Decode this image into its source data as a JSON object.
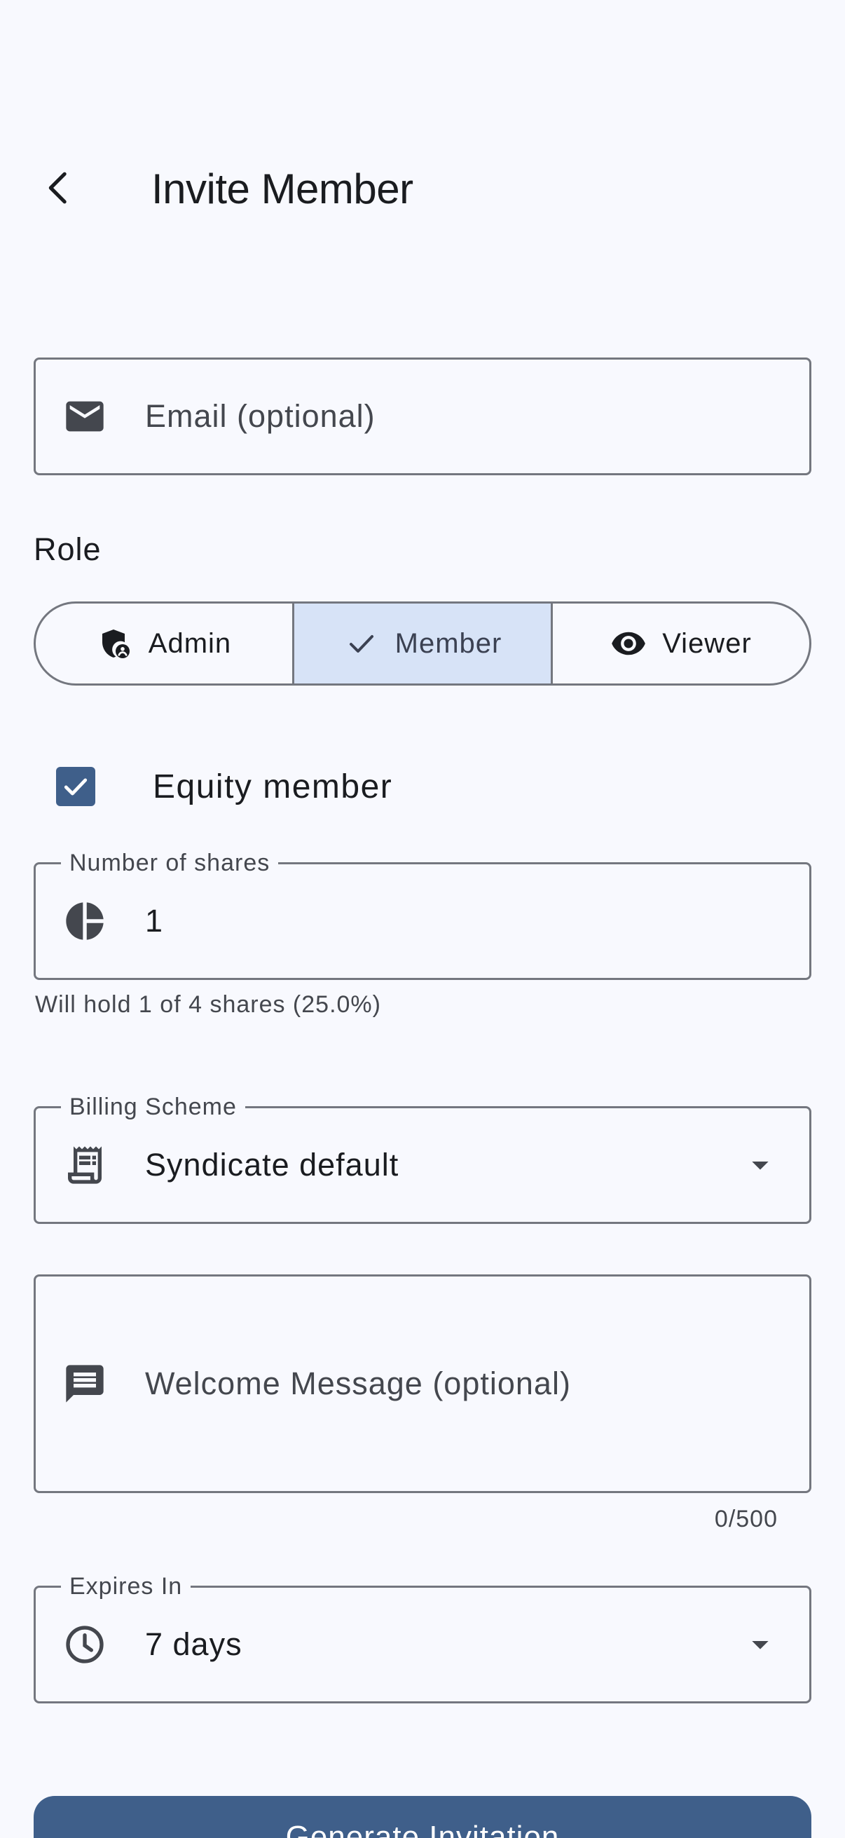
{
  "header": {
    "title": "Invite Member"
  },
  "email": {
    "placeholder": "Email (optional)"
  },
  "role": {
    "label": "Role",
    "options": [
      {
        "label": "Admin",
        "icon": "admin-shield-icon",
        "selected": false
      },
      {
        "label": "Member",
        "icon": "check-icon",
        "selected": true
      },
      {
        "label": "Viewer",
        "icon": "eye-icon",
        "selected": false
      }
    ]
  },
  "equity": {
    "label": "Equity member",
    "checked": true
  },
  "shares": {
    "label": "Number of shares",
    "value": "1",
    "helper": "Will hold 1 of 4 shares (25.0%)"
  },
  "billing": {
    "label": "Billing Scheme",
    "value": "Syndicate default"
  },
  "welcome": {
    "placeholder": "Welcome Message (optional)",
    "counter": "0/500"
  },
  "expires": {
    "label": "Expires In",
    "value": "7 days"
  },
  "actions": {
    "generate_label": "Generate Invitation"
  },
  "colors": {
    "background": "#f8f9fe",
    "primary": "#3f5f8a",
    "selected_segment": "#d7e3f7",
    "outline": "#74777f",
    "on_surface": "#1a1c20",
    "on_surface_variant": "#44474e"
  }
}
